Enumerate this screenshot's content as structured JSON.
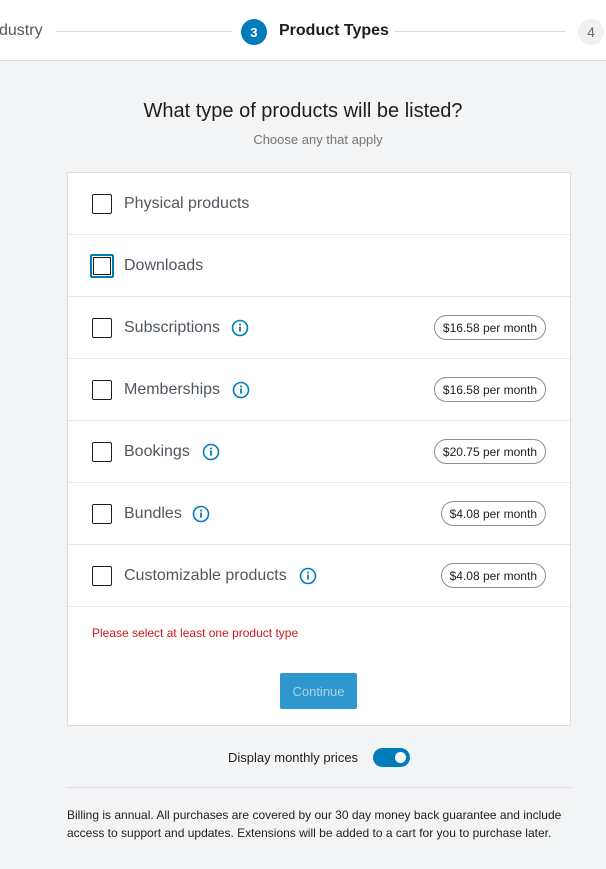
{
  "stepper": {
    "prev_label": "dustry",
    "current_number": "3",
    "current_label": "Product Types",
    "next_number": "4"
  },
  "heading": {
    "title": "What type of products will be listed?",
    "subtitle": "Choose any that apply"
  },
  "products": [
    {
      "label": "Physical products",
      "checked": false,
      "info": false,
      "price": ""
    },
    {
      "label": "Downloads",
      "checked": false,
      "focused": true,
      "info": false,
      "price": ""
    },
    {
      "label": "Subscriptions",
      "checked": false,
      "info": true,
      "price": "$16.58 per month"
    },
    {
      "label": "Memberships",
      "checked": false,
      "info": true,
      "price": "$16.58 per month"
    },
    {
      "label": "Bookings",
      "checked": false,
      "info": true,
      "price": "$20.75 per month"
    },
    {
      "label": "Bundles",
      "checked": false,
      "info": true,
      "price": "$4.08 per month"
    },
    {
      "label": "Customizable products",
      "checked": false,
      "info": true,
      "price": "$4.08 per month"
    }
  ],
  "error": "Please select at least one product type",
  "continue_label": "Continue",
  "monthly_toggle": {
    "label": "Display monthly prices",
    "on": true
  },
  "billing_note": "Billing is annual. All purchases are covered by our 30 day money back guarantee and include access to support and updates. Extensions will be added to a cart for you to purchase later.",
  "colors": {
    "accent": "#007cba",
    "error": "#cc1818"
  },
  "icons": {
    "info": "info-icon"
  }
}
